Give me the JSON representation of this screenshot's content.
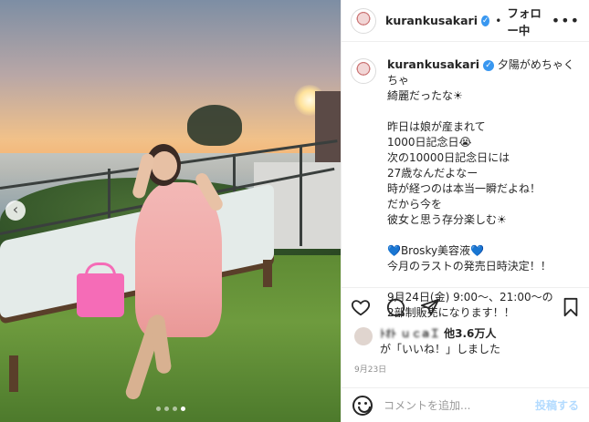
{
  "header": {
    "username": "kurankusakari",
    "separator": "•",
    "follow_status": "フォロー中",
    "more": "•••"
  },
  "caption": {
    "username": "kurankusakari",
    "lines": [
      "夕陽がめちゃくちゃ",
      "綺麗だったな☀",
      "",
      "昨日は娘が産まれて",
      "1000日記念日😭",
      "次の10000日記念日には",
      "27歳なんだよなー",
      "時が経つのは本当一瞬だよね！",
      "だから今を",
      "彼女と思う存分楽しむ☀",
      "",
      "💙Brosky美容液💙",
      "今月のラストの発売日時決定！！",
      "",
      "9月24日(金) 9:00〜、21:00〜の",
      "2部制販売になります！！"
    ]
  },
  "likes": {
    "blurred_name": "ﾄｵﾄ ｕｃaＩ",
    "others": "他3.6万人",
    "line2": "が「いいね！」しました"
  },
  "date": "9月23日",
  "comment": {
    "placeholder": "コメントを追加...",
    "post_label": "投稿する"
  },
  "carousel": {
    "prev_arrow": "‹",
    "dot_count": 4,
    "active_dot": 3
  },
  "colors": {
    "verified": "#3897f0",
    "post_button": "#b3dbff",
    "bag": "#f56cb7",
    "dress": "#f1a9a8"
  }
}
